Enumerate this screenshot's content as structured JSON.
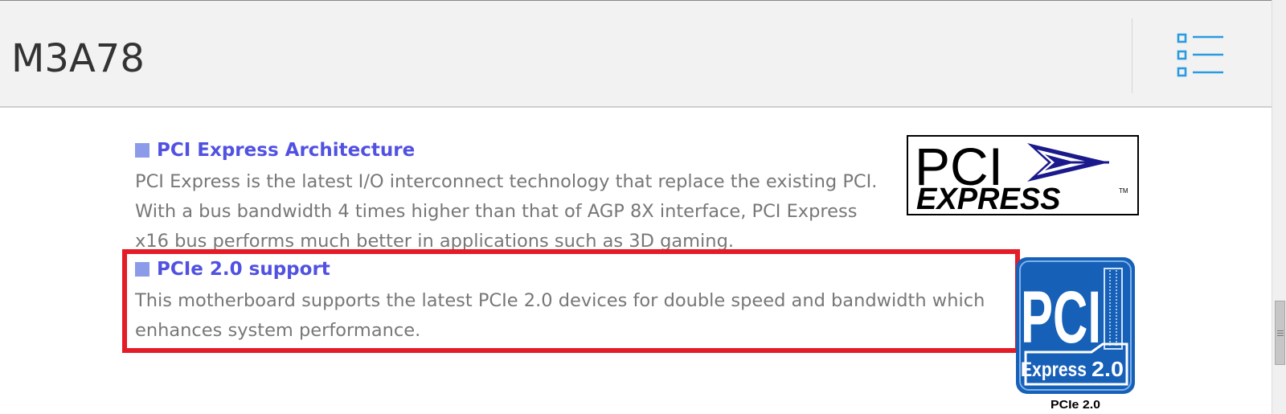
{
  "header": {
    "title": "M3A78",
    "menu_icon": "list-menu-icon"
  },
  "colors": {
    "header_bg": "#f2f2f2",
    "heading": "#5151e2",
    "bullet": "#8b9bea",
    "body_text": "#777777",
    "highlight": "#e41c28",
    "menu_icon": "#2a9be0"
  },
  "sections": [
    {
      "title": "PCI Express Architecture",
      "lines": [
        "PCI Express is the latest I/O interconnect technology that replace the existing PCI.",
        "With a bus bandwidth 4 times higher than that of AGP 8X interface, PCI Express",
        "x16 bus performs much better in applications such as 3D gaming."
      ],
      "logo": {
        "icon": "pci-express-logo",
        "text_top": "PCI",
        "text_bottom": "EXPRESS",
        "trademark": "TM"
      }
    },
    {
      "title": "PCIe 2.0 support",
      "lines": [
        "This motherboard supports the latest PCIe 2.0 devices for double speed and bandwidth which",
        "enhances system performance."
      ],
      "highlighted": true,
      "logo": {
        "icon": "pcie-2-logo",
        "text_main": "PCI",
        "text_express": "Express",
        "text_version": "2.0",
        "caption": "PCIe 2.0"
      }
    }
  ]
}
